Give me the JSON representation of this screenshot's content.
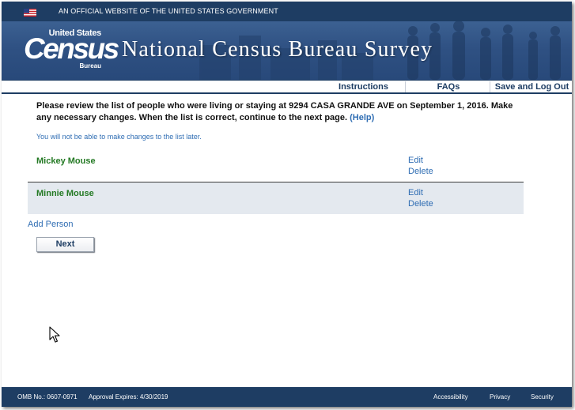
{
  "gov_banner": {
    "text": "AN OFFICIAL WEBSITE OF THE UNITED STATES GOVERNMENT"
  },
  "header": {
    "logo_top": "United States",
    "logo_main": "Census",
    "logo_bottom": "Bureau",
    "title": "National Census Bureau Survey"
  },
  "nav": {
    "instructions": "Instructions",
    "faqs": "FAQs",
    "logout": "Save and Log Out"
  },
  "content": {
    "instructions": "Please review the list of people who were living or staying at 9294 CASA GRANDE AVE on September 1, 2016. Make any necessary changes. When the list is correct, continue to the next page.",
    "help_label": "(Help)",
    "note": "You will not be able to make changes to the list later.",
    "people": [
      {
        "name": "Mickey Mouse",
        "edit": "Edit",
        "delete": "Delete"
      },
      {
        "name": "Minnie Mouse",
        "edit": "Edit",
        "delete": "Delete"
      }
    ],
    "add_person": "Add Person",
    "next_label": "Next"
  },
  "footer": {
    "omb": "OMB No.: 0607-0971",
    "approval": "Approval Expires: 4/30/2019",
    "accessibility": "Accessibility",
    "privacy": "Privacy",
    "security": "Security"
  },
  "colors": {
    "banner": "#1e3d63",
    "header": "#2f5183",
    "link": "#2f6db3",
    "name_green": "#247a24",
    "alt_row": "#e4e9ef"
  },
  "icons": [
    "us-flag-icon",
    "mouse-cursor-icon"
  ]
}
